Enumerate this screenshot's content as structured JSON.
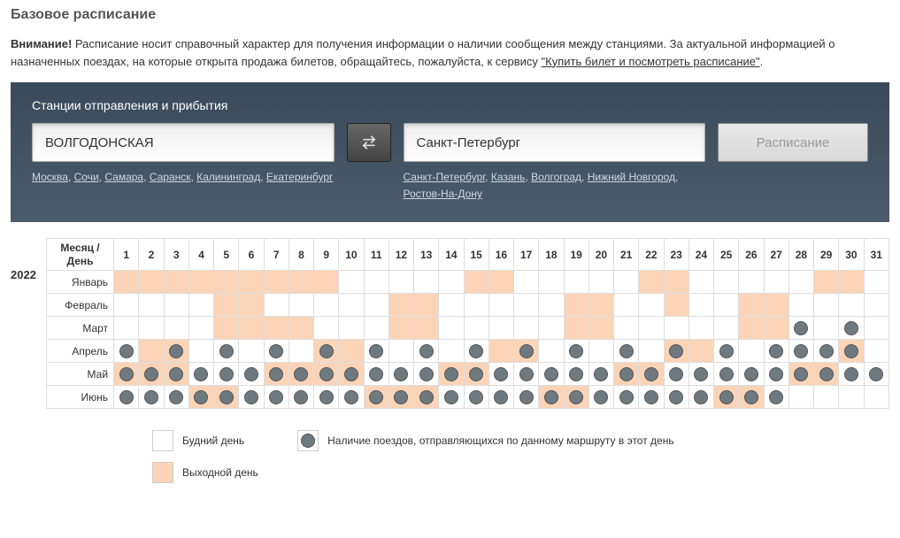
{
  "page_title": "Базовое расписание",
  "notice": {
    "strong": "Внимание!",
    "text": " Расписание носит справочный характер для получения информации о наличии сообщения между станциями. За актуальной информацией о назначенных поездах, на которые открыта продажа билетов, обращайтесь, пожалуйста, к сервису ",
    "link": "\"Купить билет и посмотреть расписание\"",
    "tail": "."
  },
  "panel": {
    "title": "Станции отправления и прибытия",
    "from": "ВОЛГОДОНСКАЯ",
    "to": "Санкт-Петербург",
    "schedule_btn": "Расписание",
    "from_quick": [
      "Москва",
      "Сочи",
      "Самара",
      "Саранск",
      "Калининград",
      "Екатеринбург"
    ],
    "to_quick": [
      "Санкт-Петербург",
      "Казань",
      "Волгоград",
      "Нижний Новгород",
      "Ростов-На-Дону"
    ]
  },
  "schedule": {
    "year": "2022",
    "head_label": "Месяц / День",
    "days": [
      "1",
      "2",
      "3",
      "4",
      "5",
      "6",
      "7",
      "8",
      "9",
      "10",
      "11",
      "12",
      "13",
      "14",
      "15",
      "16",
      "17",
      "18",
      "19",
      "20",
      "21",
      "22",
      "23",
      "24",
      "25",
      "26",
      "27",
      "28",
      "29",
      "30",
      "31"
    ],
    "months": [
      {
        "name": "Январь",
        "cells": 31,
        "holidays": [
          1,
          2,
          3,
          4,
          5,
          6,
          7,
          8,
          9,
          15,
          16,
          22,
          23,
          29,
          30
        ],
        "trains": []
      },
      {
        "name": "Февраль",
        "cells": 31,
        "holidays": [
          5,
          6,
          12,
          13,
          19,
          20,
          23,
          26,
          27
        ],
        "trains": []
      },
      {
        "name": "Март",
        "cells": 31,
        "holidays": [
          5,
          6,
          7,
          8,
          12,
          13,
          19,
          20,
          26,
          27
        ],
        "trains": [
          28,
          30
        ]
      },
      {
        "name": "Апрель",
        "cells": 31,
        "holidays": [
          2,
          3,
          9,
          10,
          16,
          17,
          23,
          24,
          30
        ],
        "trains": [
          1,
          3,
          5,
          7,
          9,
          11,
          13,
          15,
          17,
          19,
          21,
          23,
          25,
          27,
          28,
          29,
          30
        ]
      },
      {
        "name": "Май",
        "cells": 31,
        "holidays": [
          1,
          2,
          3,
          7,
          8,
          9,
          10,
          14,
          15,
          21,
          22,
          28,
          29
        ],
        "trains": [
          1,
          2,
          3,
          4,
          5,
          6,
          7,
          8,
          9,
          10,
          11,
          12,
          13,
          14,
          15,
          16,
          17,
          18,
          19,
          20,
          21,
          22,
          23,
          24,
          25,
          26,
          27,
          28,
          29,
          30,
          31
        ]
      },
      {
        "name": "Июнь",
        "cells": 31,
        "holidays": [
          4,
          5,
          11,
          12,
          13,
          18,
          19,
          25,
          26
        ],
        "trains": [
          1,
          2,
          3,
          4,
          5,
          6,
          7,
          8,
          9,
          10,
          11,
          12,
          13,
          14,
          15,
          16,
          17,
          18,
          19,
          20,
          21,
          22,
          23,
          24,
          25,
          26,
          27
        ]
      }
    ]
  },
  "legend": {
    "weekday": "Будний день",
    "holiday": "Выходной день",
    "train": "Наличие поездов, отправляющихся по данному маршруту в этот день"
  }
}
